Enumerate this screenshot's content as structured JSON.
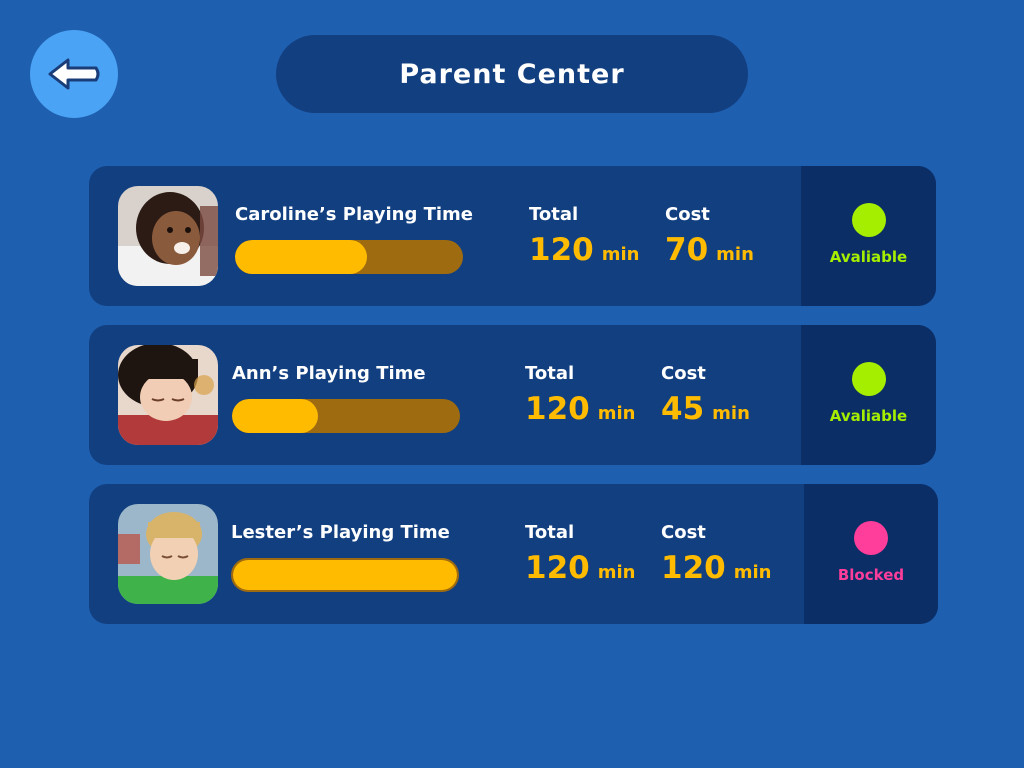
{
  "header": {
    "title": "Parent Center"
  },
  "colors": {
    "available": "#a6ee00",
    "blocked": "#ff3d9a",
    "accent": "#ffbb00"
  },
  "children": [
    {
      "name_label": "Caroline’s Playing Time",
      "total_label": "Total",
      "total_value": "120",
      "total_unit": "min",
      "cost_label": "Cost",
      "cost_value": "70",
      "cost_unit": "min",
      "usage_fraction": 0.58,
      "status": "Avaliable",
      "status_color": "#a6ee00",
      "avatar": "girl-photo"
    },
    {
      "name_label": "Ann’s Playing Time",
      "total_label": "Total",
      "total_value": "120",
      "total_unit": "min",
      "cost_label": "Cost",
      "cost_value": "45",
      "cost_unit": "min",
      "usage_fraction": 0.375,
      "status": "Avaliable",
      "status_color": "#a6ee00",
      "avatar": "girl-photo"
    },
    {
      "name_label": "Lester’s Playing Time",
      "total_label": "Total",
      "total_value": "120",
      "total_unit": "min",
      "cost_label": "Cost",
      "cost_value": "120",
      "cost_unit": "min",
      "usage_fraction": 1.0,
      "status": "Blocked",
      "status_color": "#ff3d9a",
      "avatar": "boy-photo"
    }
  ]
}
